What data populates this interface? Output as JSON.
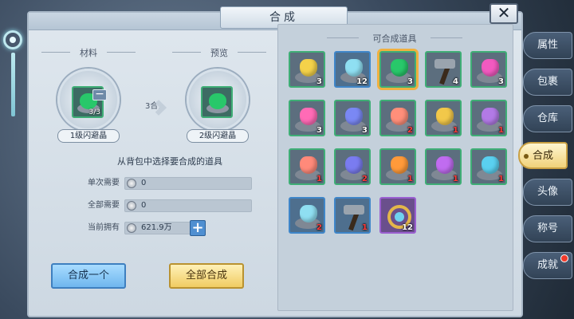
{
  "title": "合成",
  "close_icon": "close-icon",
  "left": {
    "materials_header": "材料",
    "preview_header": "预览",
    "material_slot_count": "3/3",
    "material_name": "1级闪避晶",
    "ratio_label": "3合1",
    "preview_name": "2级闪避晶",
    "instruction": "从背包中选择要合成的道具",
    "rows": [
      {
        "label": "单次需要",
        "value": "0"
      },
      {
        "label": "全部需要",
        "value": "0"
      },
      {
        "label": "当前拥有",
        "value": "621.9万"
      }
    ],
    "btn_single": "合成一个",
    "btn_all": "全部合成"
  },
  "right": {
    "header": "可合成道具",
    "items": [
      {
        "kind": "gem",
        "color": "#f4d24a",
        "frame": "green",
        "count": "3",
        "red": false
      },
      {
        "kind": "gem",
        "color": "#8fdff2",
        "frame": "blue",
        "count": "12",
        "red": false
      },
      {
        "kind": "gem",
        "color": "#28c86a",
        "frame": "green",
        "count": "3",
        "red": false,
        "selected": true
      },
      {
        "kind": "hammer",
        "color": "#9aa4ae",
        "frame": "green",
        "count": "4",
        "red": false
      },
      {
        "kind": "gem",
        "color": "#f25ac0",
        "frame": "green",
        "count": "3",
        "red": false
      },
      {
        "kind": "gem",
        "color": "#ff6bb6",
        "frame": "green",
        "count": "3",
        "red": false
      },
      {
        "kind": "gem",
        "color": "#7a88f4",
        "frame": "green",
        "count": "3",
        "red": false
      },
      {
        "kind": "gem",
        "color": "#ff8f7a",
        "frame": "green",
        "count": "2",
        "red": true
      },
      {
        "kind": "gem",
        "color": "#f2c84a",
        "frame": "green",
        "count": "1",
        "red": true
      },
      {
        "kind": "gem",
        "color": "#b27ae6",
        "frame": "green",
        "count": "1",
        "red": true
      },
      {
        "kind": "gem",
        "color": "#ff8a7a",
        "frame": "green",
        "count": "1",
        "red": true
      },
      {
        "kind": "gem",
        "color": "#7a7cf0",
        "frame": "green",
        "count": "2",
        "red": true
      },
      {
        "kind": "gem",
        "color": "#ff9a3a",
        "frame": "green",
        "count": "1",
        "red": true
      },
      {
        "kind": "gem",
        "color": "#c06cf0",
        "frame": "green",
        "count": "1",
        "red": true
      },
      {
        "kind": "gem",
        "color": "#5ad0f0",
        "frame": "green",
        "count": "1",
        "red": true
      },
      {
        "kind": "gem",
        "color": "#8fdff2",
        "frame": "blue",
        "count": "2",
        "red": true
      },
      {
        "kind": "hammer",
        "color": "#9aa4ae",
        "frame": "blue",
        "count": "1",
        "red": true
      },
      {
        "kind": "ring",
        "color": "#e3b64a",
        "frame": "purple",
        "count": "12",
        "red": false
      }
    ]
  },
  "tabs": [
    {
      "label": "属性",
      "active": false,
      "dot": false
    },
    {
      "label": "包裹",
      "active": false,
      "dot": false
    },
    {
      "label": "仓库",
      "active": false,
      "dot": false
    },
    {
      "label": "合成",
      "active": true,
      "dot": false
    },
    {
      "label": "头像",
      "active": false,
      "dot": false
    },
    {
      "label": "称号",
      "active": false,
      "dot": false
    },
    {
      "label": "成就",
      "active": false,
      "dot": true
    }
  ]
}
